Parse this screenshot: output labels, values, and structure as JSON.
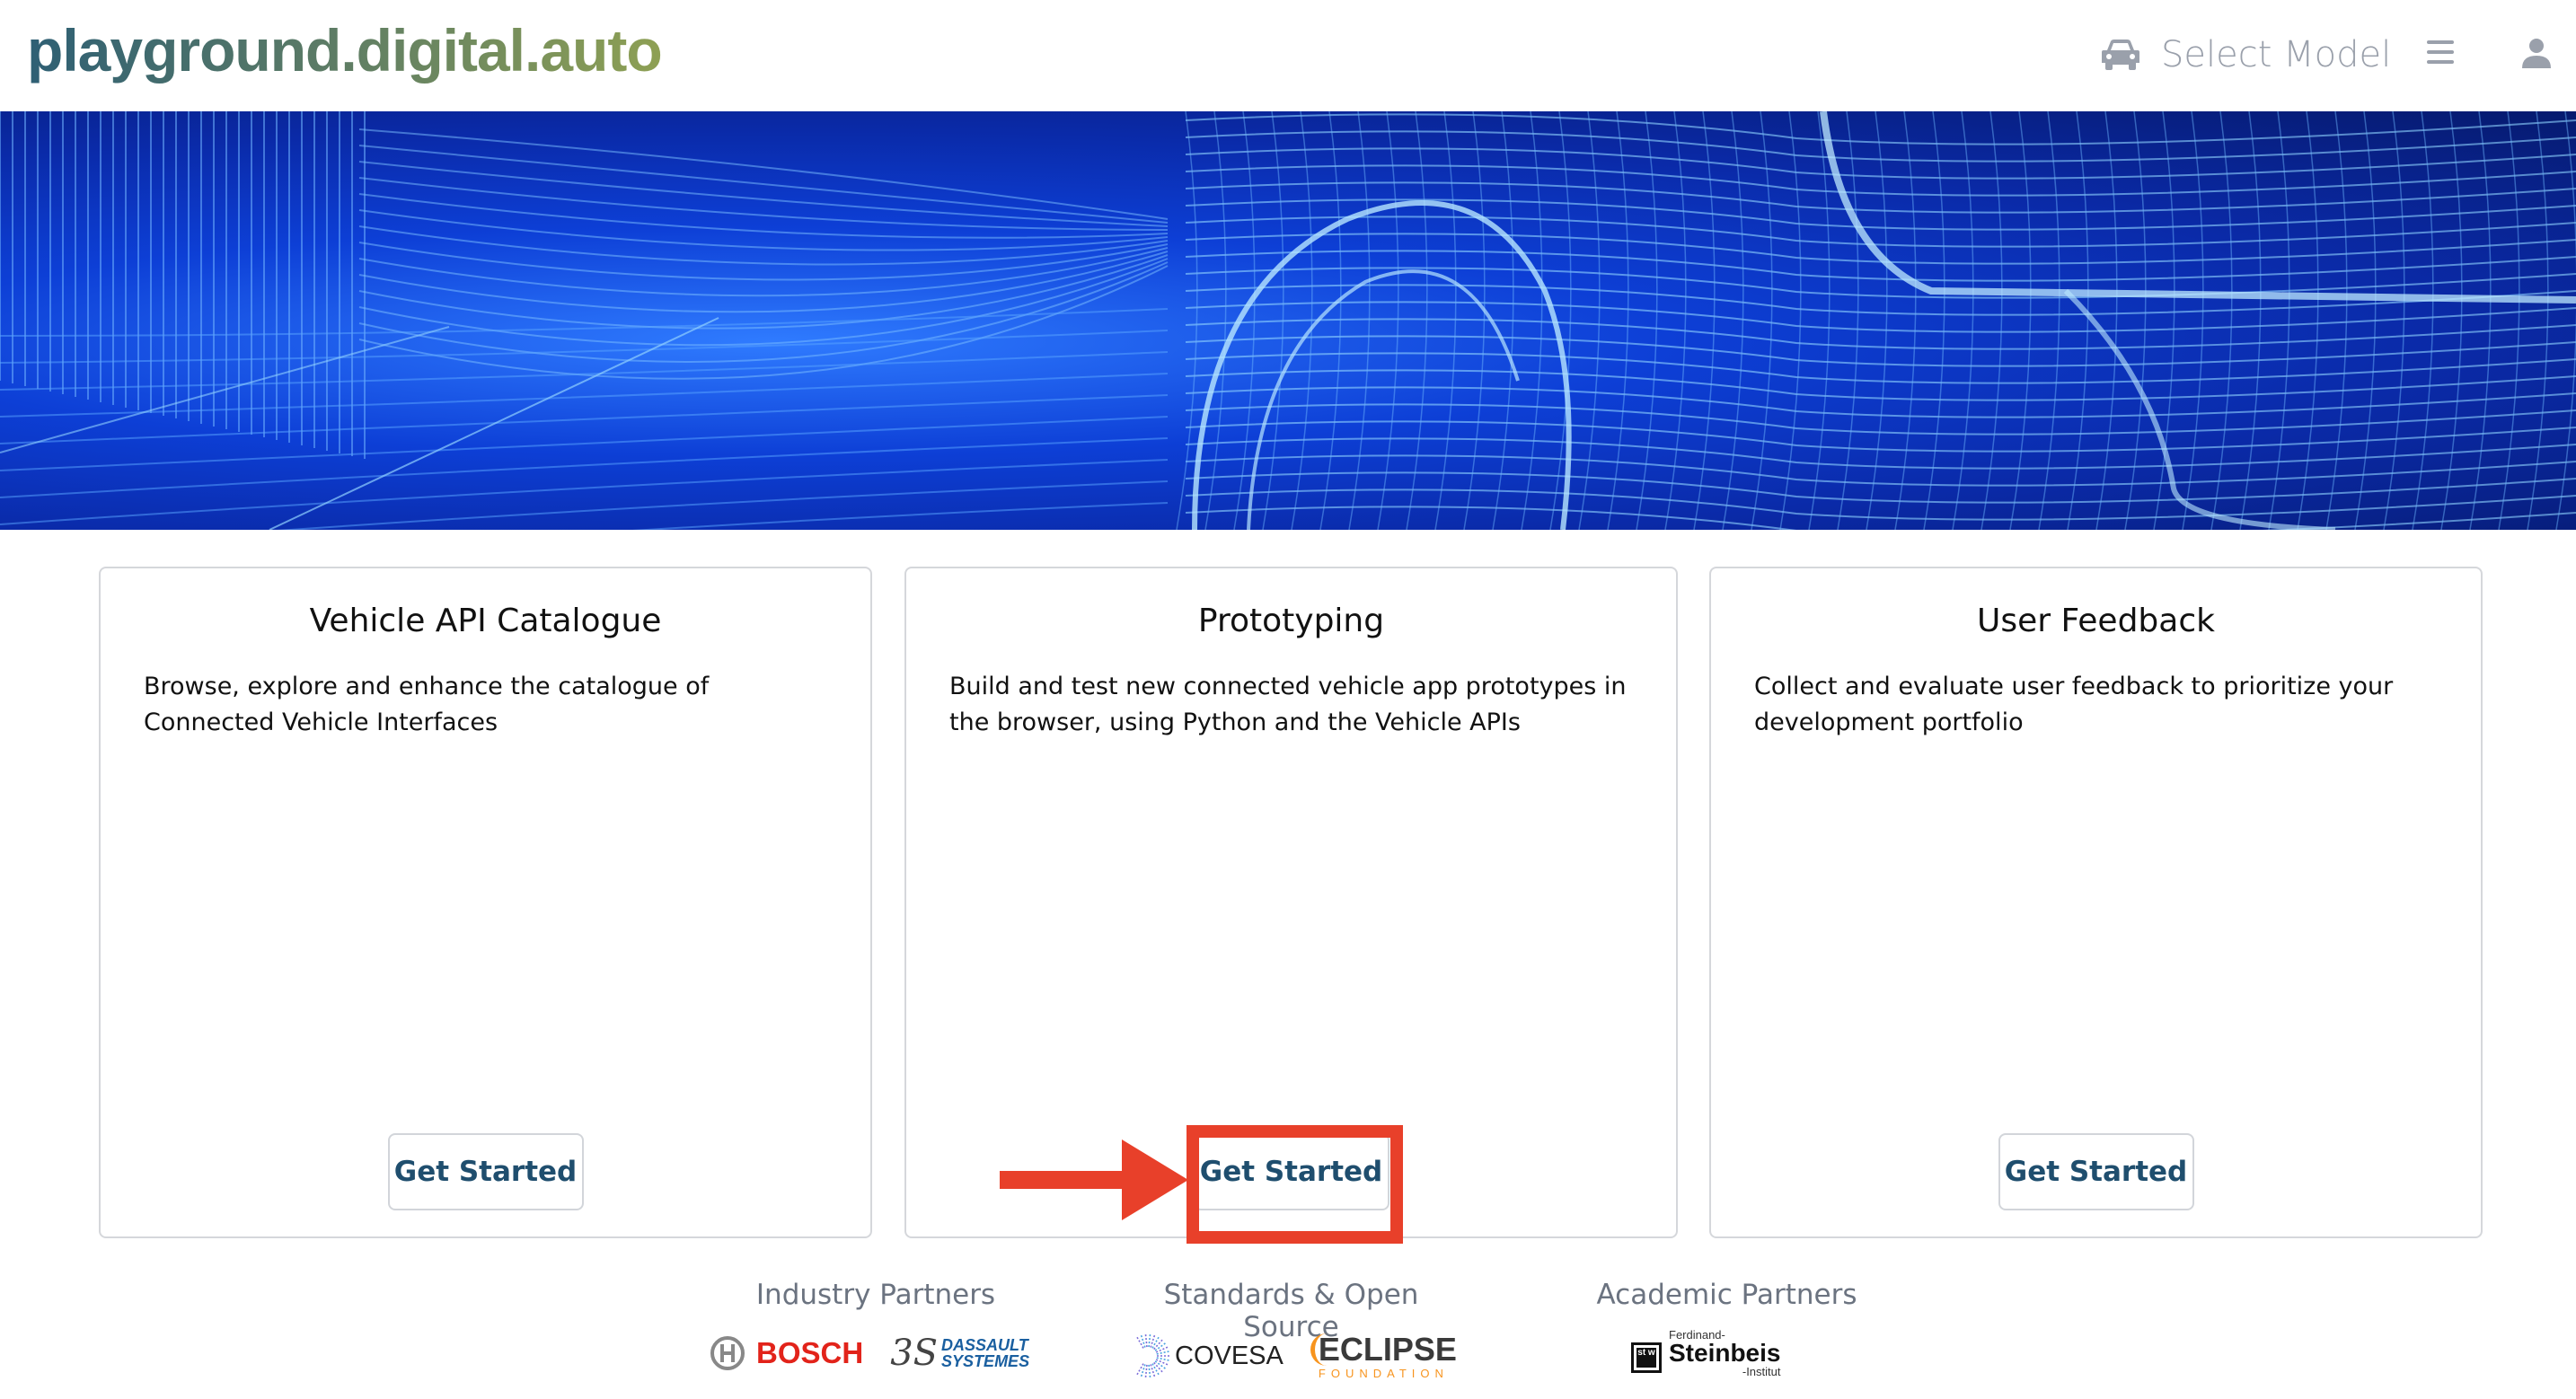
{
  "header": {
    "logo_text": "playground.digital.auto",
    "select_model_label": "Select Model",
    "icons": [
      "car-icon",
      "menu-icon",
      "user-icon"
    ]
  },
  "banner": {
    "description": "blue wireframe car and road"
  },
  "cards": [
    {
      "title": "Vehicle API Catalogue",
      "description": "Browse, explore and enhance the catalogue of Connected Vehicle Interfaces",
      "button_label": "Get Started"
    },
    {
      "title": "Prototyping",
      "description": "Build and test new connected vehicle app prototypes in the browser, using Python and the Vehicle APIs",
      "button_label": "Get Started",
      "highlighted": true
    },
    {
      "title": "User Feedback",
      "description": "Collect and evaluate user feedback to prioritize your development portfolio",
      "button_label": "Get Started"
    }
  ],
  "partners": {
    "industry": {
      "label": "Industry Partners",
      "logos": [
        "BOSCH",
        "DASSAULT",
        "SYSTEMES"
      ]
    },
    "standards": {
      "label": "Standards & Open Source",
      "logos": [
        "COVESA",
        "ECLIPSE",
        "FOUNDATION"
      ]
    },
    "academic": {
      "label": "Academic Partners",
      "logo_top": "Ferdinand-",
      "logo_main": "Steinbeis",
      "logo_bottom": "-Institut",
      "logo_mark": "st w"
    }
  },
  "colors": {
    "highlight": "#e8402a",
    "button_text": "#1f4e6e",
    "nav_gray": "#9aa0ab",
    "bosch_red": "#e2231a",
    "eclipse_orange": "#f7941e",
    "dassault_blue": "#1a5fa0"
  }
}
